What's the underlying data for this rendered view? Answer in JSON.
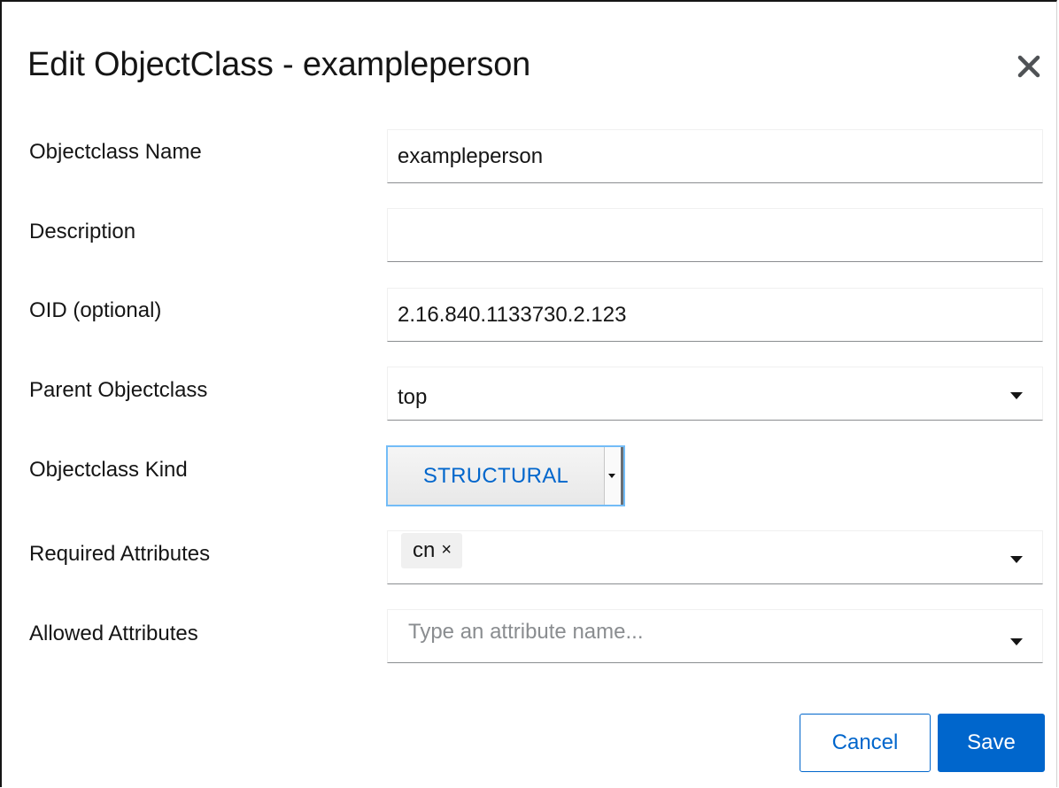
{
  "dialog": {
    "title": "Edit ObjectClass - exampleperson",
    "close_icon": "close-icon"
  },
  "form": {
    "name": {
      "label": "Objectclass Name",
      "value": "exampleperson"
    },
    "description": {
      "label": "Description",
      "value": ""
    },
    "oid": {
      "label": "OID (optional)",
      "value": "2.16.840.1133730.2.123"
    },
    "parent": {
      "label": "Parent Objectclass",
      "value": "top"
    },
    "kind": {
      "label": "Objectclass Kind",
      "value": "STRUCTURAL"
    },
    "required": {
      "label": "Required Attributes",
      "chips": [
        "cn"
      ],
      "chip_remove": "×"
    },
    "allowed": {
      "label": "Allowed Attributes",
      "placeholder": "Type an attribute name..."
    }
  },
  "footer": {
    "cancel_label": "Cancel",
    "save_label": "Save"
  },
  "colors": {
    "primary": "#0066cc",
    "text": "#151515",
    "placeholder": "#8a8d90",
    "focus": "#73bcf7"
  }
}
